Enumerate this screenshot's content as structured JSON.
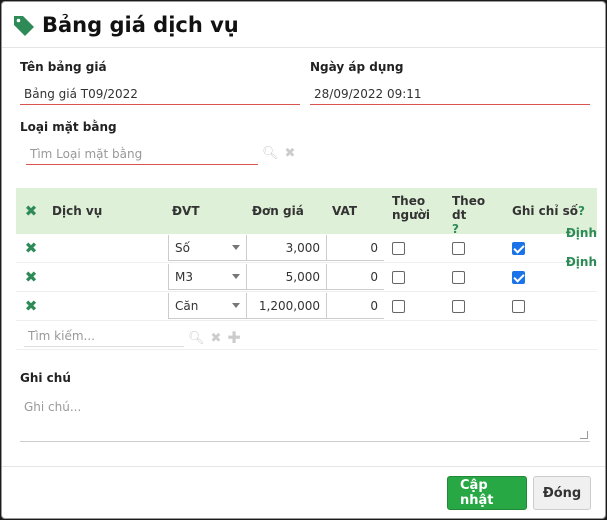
{
  "dialog": {
    "title": "Bảng giá dịch vụ",
    "icon": "tag-icon"
  },
  "form": {
    "name_label": "Tên bảng giá",
    "name_value": "Bảng giá T09/2022",
    "date_label": "Ngày áp dụng",
    "date_value": "28/09/2022 09:11",
    "type_label": "Loại mặt bằng",
    "type_placeholder": "Tìm Loại mặt bằng"
  },
  "grid": {
    "headers": [
      "Dịch vụ",
      "ĐVT",
      "Đơn giá",
      "VAT",
      "Theo người",
      "Theo dt",
      "Ghi chỉ số"
    ],
    "headers_with_help": [
      "Theo dt",
      "Ghi chỉ số"
    ],
    "rows": [
      {
        "service": "",
        "unit": "Số",
        "price": "3,000",
        "vat": "0",
        "by_person": false,
        "by_area": false,
        "meter": true,
        "extra": "Định"
      },
      {
        "service": "",
        "unit": "M3",
        "price": "5,000",
        "vat": "0",
        "by_person": false,
        "by_area": false,
        "meter": true,
        "extra": "Định"
      },
      {
        "service": "",
        "unit": "Căn",
        "price": "1,200,000",
        "vat": "0",
        "by_person": false,
        "by_area": false,
        "meter": false,
        "extra": ""
      }
    ],
    "search_placeholder": "Tìm kiếm..."
  },
  "notes": {
    "label": "Ghi chú",
    "placeholder": "Ghi chú..."
  },
  "footer": {
    "update_label": "Cập nhật",
    "close_label": "Đóng"
  },
  "colors": {
    "accent": "#28a745",
    "header_bg": "#dff0d8",
    "error_line": "#d9534f"
  }
}
